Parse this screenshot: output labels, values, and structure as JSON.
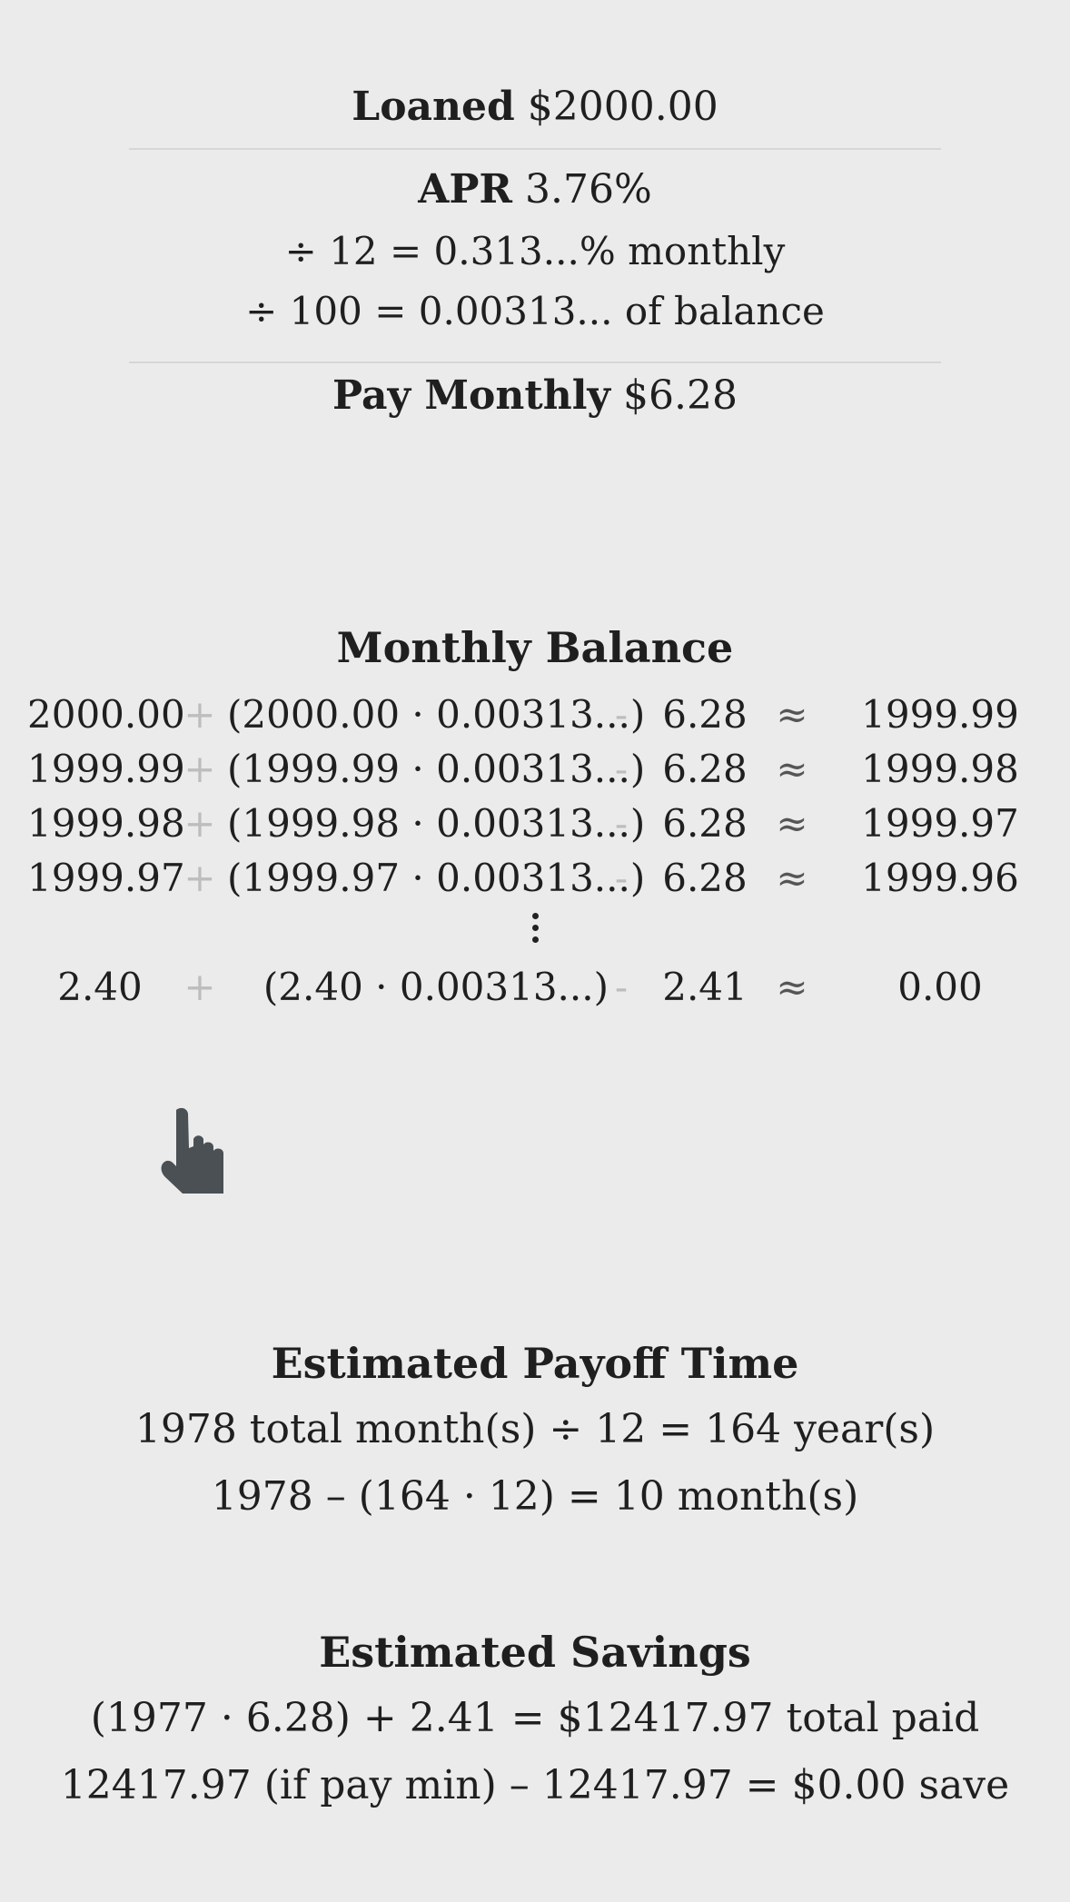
{
  "loan": {
    "loaned_label": "Loaned",
    "loaned_value": "$2000.00",
    "apr_label": "APR",
    "apr_value": "3.76%",
    "monthly_rate_line": "÷ 12 = 0.313...% monthly",
    "balance_rate_line": "÷ 100 = 0.00313... of balance",
    "pay_monthly_label": "Pay Monthly",
    "pay_monthly_value": "$6.28"
  },
  "monthly_balance": {
    "title": "Monthly Balance",
    "rows": [
      {
        "start": "2000.00",
        "plus": "+",
        "paren": "(2000.00 · 0.00313...)",
        "minus": "-",
        "payment": "6.28",
        "approx": "≈",
        "result": "1999.99"
      },
      {
        "start": "1999.99",
        "plus": "+",
        "paren": "(1999.99 · 0.00313...)",
        "minus": "-",
        "payment": "6.28",
        "approx": "≈",
        "result": "1999.98"
      },
      {
        "start": "1999.98",
        "plus": "+",
        "paren": "(1999.98 · 0.00313...)",
        "minus": "-",
        "payment": "6.28",
        "approx": "≈",
        "result": "1999.97"
      },
      {
        "start": "1999.97",
        "plus": "+",
        "paren": "(1999.97 · 0.00313...)",
        "minus": "-",
        "payment": "6.28",
        "approx": "≈",
        "result": "1999.96"
      },
      {
        "start": "2.40",
        "plus": "+",
        "paren": "(2.40 · 0.00313...)",
        "minus": "-",
        "payment": "2.41",
        "approx": "≈",
        "result": "0.00"
      }
    ]
  },
  "payoff": {
    "title": "Estimated Payoff Time",
    "line1": "1978 total month(s) ÷ 12 = 164 year(s)",
    "line2": "1978 – (164 · 12) = 10 month(s)"
  },
  "savings": {
    "title": "Estimated Savings",
    "line1": "(1977 · 6.28) + 2.41 = $12417.97 total paid",
    "line2": "12417.97 (if pay min) – 12417.97 = $0.00 save"
  },
  "colors": {
    "background": "#ebebeb",
    "text": "#1f1f1f",
    "operator_muted": "#bdbdbd",
    "cursor": "#4a5054"
  },
  "icons": {
    "cursor": "hand-pointer-icon"
  }
}
